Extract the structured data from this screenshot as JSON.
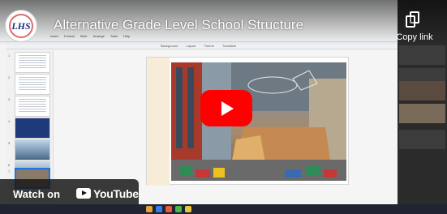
{
  "video": {
    "title": "Alternative Grade Level School Structure",
    "copy_link_label": "Copy link",
    "watch_on_label": "Watch on",
    "platform_label": "YouTube",
    "channel_avatar_text": "LHS"
  },
  "editor": {
    "menu": [
      "Insert",
      "Format",
      "Slide",
      "Arrange",
      "Tools",
      "Help"
    ],
    "toolbar": [
      "Background",
      "Layout",
      "Theme",
      "Transition"
    ],
    "slide_numbers": [
      "1",
      "2",
      "3",
      "4",
      "5",
      "6",
      "7"
    ]
  },
  "colors": {
    "play_button": "#ff0000",
    "title_text": "#ffffff",
    "selected_thumb": "#1a73e8"
  }
}
